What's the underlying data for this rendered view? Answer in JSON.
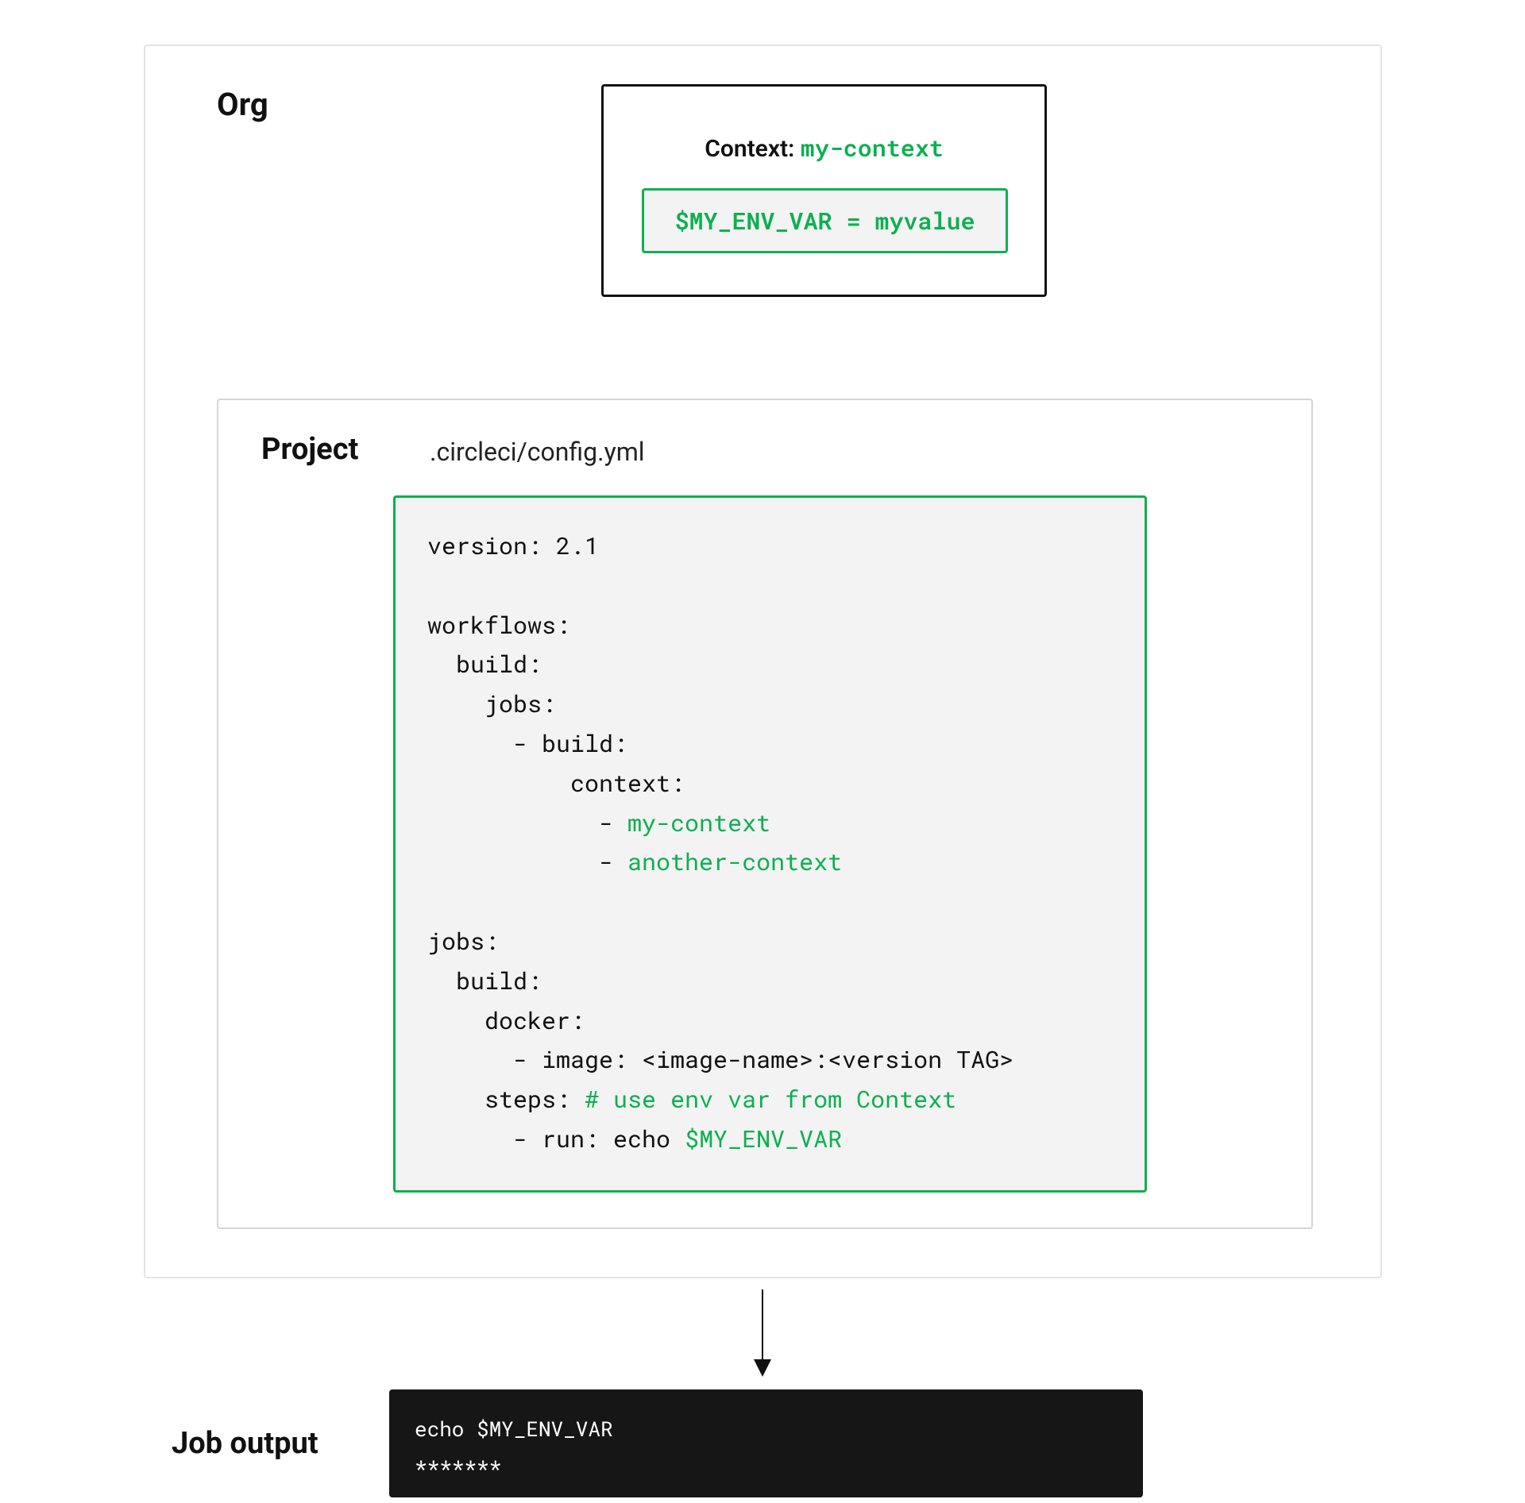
{
  "org": {
    "title": "Org",
    "context": {
      "label_prefix": "Context: ",
      "name": "my-context",
      "env_var": "$MY_ENV_VAR = myvalue"
    }
  },
  "project": {
    "title": "Project",
    "filename": ".circleci/config.yml",
    "config": {
      "l01": "version: 2.1",
      "l02": "",
      "l03": "workflows:",
      "l04": "  build:",
      "l05": "    jobs:",
      "l06": "      - build:",
      "l07": "          context:",
      "l08a": "            - ",
      "l08b": "my-context",
      "l09a": "            - ",
      "l09b": "another-context",
      "l10": "",
      "l11": "jobs:",
      "l12": "  build:",
      "l13": "    docker:",
      "l14": "      - image: <image-name>:<version TAG>",
      "l15a": "    steps: ",
      "l15b": "# use env var from Context",
      "l16a": "      - run: echo ",
      "l16b": "$MY_ENV_VAR"
    }
  },
  "job_output": {
    "label": "Job output",
    "line1": "echo $MY_ENV_VAR",
    "line2": "*******"
  }
}
